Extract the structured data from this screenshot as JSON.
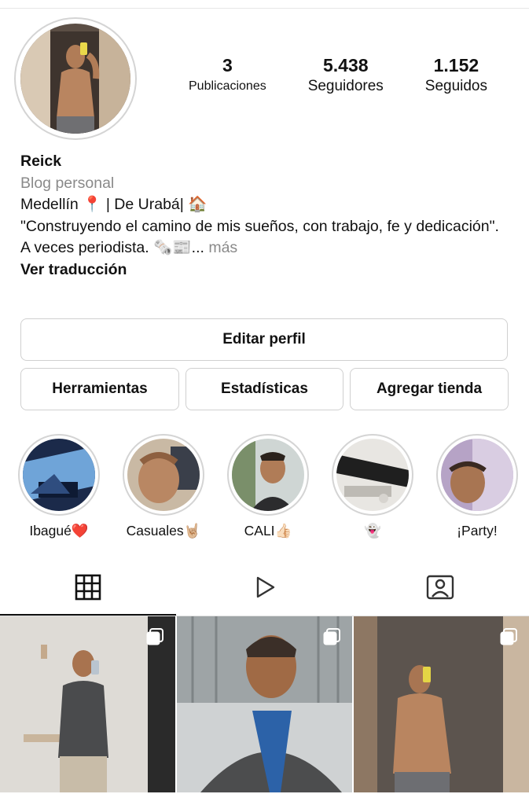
{
  "profile": {
    "name": "Reick",
    "category": "Blog personal",
    "bio_line1": "Medellín 📍 | De Urabá| 🏠",
    "bio_line2": "\"Construyendo el camino de mis sueños, con trabajo, fe y dedicación\".",
    "bio_line3": "A veces periodista. 🗞️📰...",
    "more": "más",
    "translate": "Ver traducción"
  },
  "stats": [
    {
      "value": "3",
      "label": "Publicaciones"
    },
    {
      "value": "5.438",
      "label": "Seguidores"
    },
    {
      "value": "1.152",
      "label": "Seguidos"
    }
  ],
  "buttons": {
    "edit_profile": "Editar perfil",
    "tools": "Herramientas",
    "insights": "Estadísticas",
    "add_shop": "Agregar tienda"
  },
  "highlights": [
    {
      "label": "Ibagué❤️"
    },
    {
      "label": "Casuales🤘🏼"
    },
    {
      "label": "CALI👍🏻"
    },
    {
      "label": "👻"
    },
    {
      "label": "¡Party!"
    }
  ],
  "tabs": [
    {
      "icon": "grid-icon"
    },
    {
      "icon": "reels-play-icon"
    },
    {
      "icon": "tagged-person-icon"
    }
  ],
  "colors": {
    "text": "#111111",
    "muted": "#8a8a8a",
    "border": "#d0d0d0"
  }
}
